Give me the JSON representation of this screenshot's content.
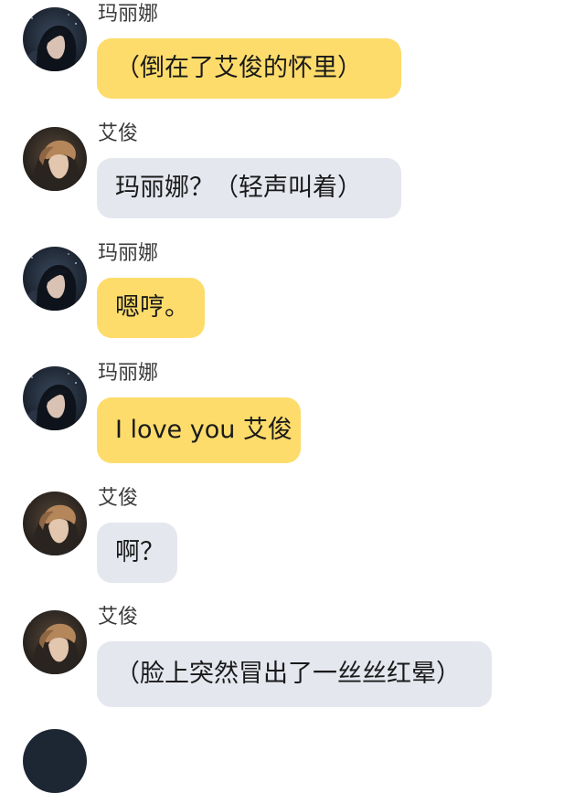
{
  "messages": [
    {
      "sender": "玛丽娜",
      "text": "（倒在了艾俊的怀里）",
      "side": "self"
    },
    {
      "sender": "艾俊",
      "text": "玛丽娜？（轻声叫着）",
      "side": "other"
    },
    {
      "sender": "玛丽娜",
      "text": "嗯哼。",
      "side": "self"
    },
    {
      "sender": "玛丽娜",
      "text": "I love you 艾俊",
      "side": "self"
    },
    {
      "sender": "艾俊",
      "text": "啊？",
      "side": "other"
    },
    {
      "sender": "艾俊",
      "text": "（脸上突然冒出了一丝丝红晕）",
      "side": "other"
    }
  ],
  "colors": {
    "self_bubble": "#fddc6b",
    "other_bubble": "#e4e7ee",
    "sender_text": "#3a3a3a"
  },
  "avatars": {
    "marina": "marina-avatar",
    "aijun": "aijun-avatar"
  }
}
